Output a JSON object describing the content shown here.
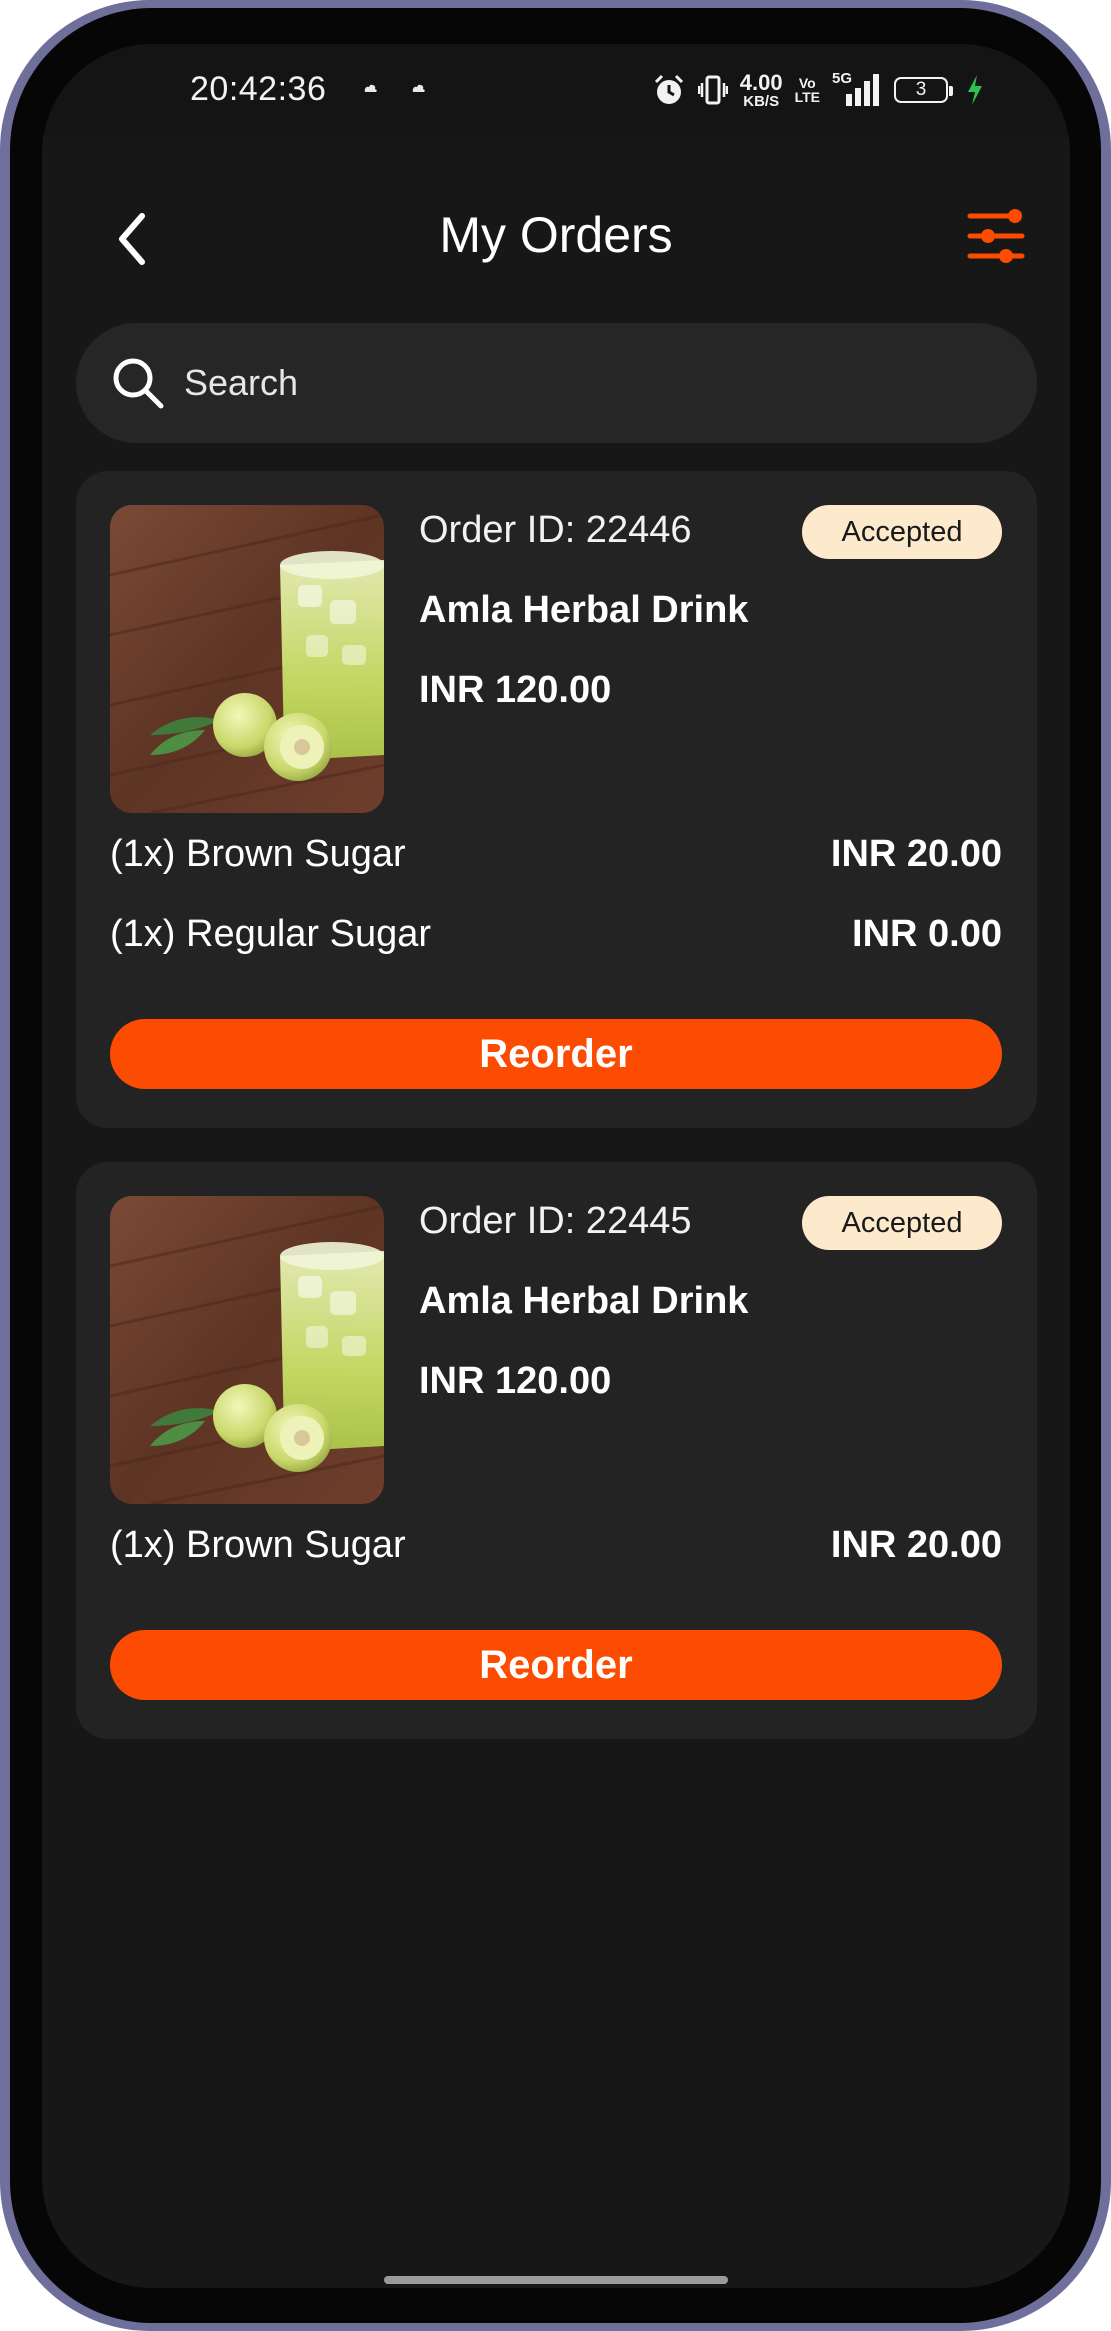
{
  "status_bar": {
    "time": "20:42:36",
    "net_speed": "4.00",
    "net_unit": "KB/S",
    "volte_top": "Vo",
    "volte_bottom": "LTE",
    "network": "5G",
    "battery": "3"
  },
  "header": {
    "title": "My Orders",
    "back_icon": "chevron-left-icon",
    "filter_icon": "sliders-icon"
  },
  "search": {
    "placeholder": "Search",
    "value": ""
  },
  "colors": {
    "accent": "#fc4c02",
    "background": "#171717",
    "card": "#232323",
    "status_pill": "#fde9cc"
  },
  "orders": [
    {
      "order_id": "Order ID: 22446",
      "status": "Accepted",
      "product_name": "Amla Herbal Drink",
      "product_price": "INR 120.00",
      "extras": [
        {
          "name": "(1x) Brown Sugar",
          "price": "INR 20.00"
        },
        {
          "name": "(1x) Regular Sugar",
          "price": "INR 0.00"
        }
      ],
      "reorder_label": "Reorder"
    },
    {
      "order_id": "Order ID: 22445",
      "status": "Accepted",
      "product_name": "Amla Herbal Drink",
      "product_price": "INR 120.00",
      "extras": [
        {
          "name": "(1x) Brown Sugar",
          "price": "INR 20.00"
        }
      ],
      "reorder_label": "Reorder"
    }
  ]
}
